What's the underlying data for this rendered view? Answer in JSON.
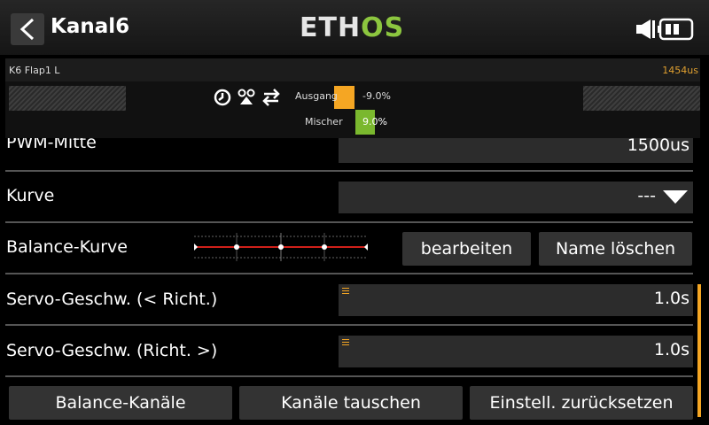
{
  "header": {
    "title": "Kanal6",
    "logo_part1": "ETH",
    "logo_part2": "OS"
  },
  "monitor": {
    "channel_label": "K6  Flap1 L",
    "pulse_value": "1454us",
    "ausgang_label": "Ausgang",
    "ausgang_value": "-9.0%",
    "mischer_label": "Mischer",
    "mischer_value": "9.0%"
  },
  "rows": {
    "pwm_mitte_label": "PWM-Mitte",
    "pwm_mitte_value": "1500us",
    "kurve_label": "Kurve",
    "kurve_value": "---",
    "balance_label": "Balance-Kurve",
    "balance_edit": "bearbeiten",
    "balance_clear": "Name löschen",
    "speed_left_label": "Servo-Geschw. (< Richt.)",
    "speed_left_value": "1.0s",
    "speed_right_label": "Servo-Geschw. (Richt. >)",
    "speed_right_value": "1.0s"
  },
  "actions": {
    "balance_channels": "Balance-Kanäle",
    "swap_channels": "Kanäle tauschen",
    "reset_settings": "Einstell. zurücksetzen"
  },
  "colors": {
    "accent": "#f5a623",
    "logo_green": "#8cc63f",
    "mixer_green": "#7ab82e",
    "curve_red": "#d0201a"
  },
  "icons": [
    "back-arrow-icon",
    "speaker-icon",
    "battery-icon",
    "clock-icon",
    "trainer-icon",
    "swap-icon",
    "dropdown-arrow-icon"
  ]
}
